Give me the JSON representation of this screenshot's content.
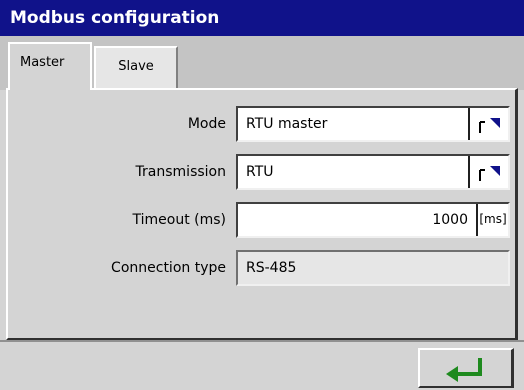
{
  "window": {
    "title": "Modbus configuration"
  },
  "tabs": [
    {
      "label": "Master",
      "active": true
    },
    {
      "label": "Slave",
      "active": false
    }
  ],
  "form": {
    "mode": {
      "label": "Mode",
      "value": "RTU master"
    },
    "transmission": {
      "label": "Transmission",
      "value": "RTU"
    },
    "timeout": {
      "label": "Timeout (ms)",
      "value": "1000",
      "unit_button": "[ms]"
    },
    "connection_type": {
      "label": "Connection type",
      "value": "RS-485"
    }
  },
  "icons": {
    "dropdown": "dropdown-arrow-icon",
    "enter": "enter-arrow-icon"
  },
  "colors": {
    "titlebar": "#10128a",
    "enter_arrow": "#1e8a1e"
  }
}
